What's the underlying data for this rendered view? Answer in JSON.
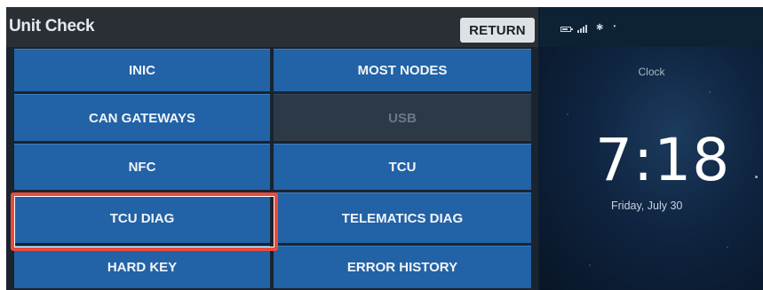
{
  "header": {
    "title": "Unit Check",
    "return_label": "RETURN"
  },
  "buttons": {
    "inic": "INIC",
    "most_nodes": "MOST NODES",
    "can_gateways": "CAN GATEWAYS",
    "usb": "USB",
    "nfc": "NFC",
    "tcu": "TCU",
    "tcu_diag": "TCU DIAG",
    "telematics_diag": "TELEMATICS DIAG",
    "hard_key": "HARD KEY",
    "error_history": "ERROR HISTORY"
  },
  "status_bar": {
    "icons": [
      "battery-icon",
      "signal-icon",
      "bluetooth-icon",
      "wifi-icon"
    ]
  },
  "clock": {
    "label": "Clock",
    "time": "7:18",
    "date": "Friday, July 30"
  },
  "colors": {
    "button_blue": "#2262a6",
    "button_disabled": "#2c3a48",
    "highlight_red": "#e94b3c",
    "header_bg": "#2a2f36"
  }
}
